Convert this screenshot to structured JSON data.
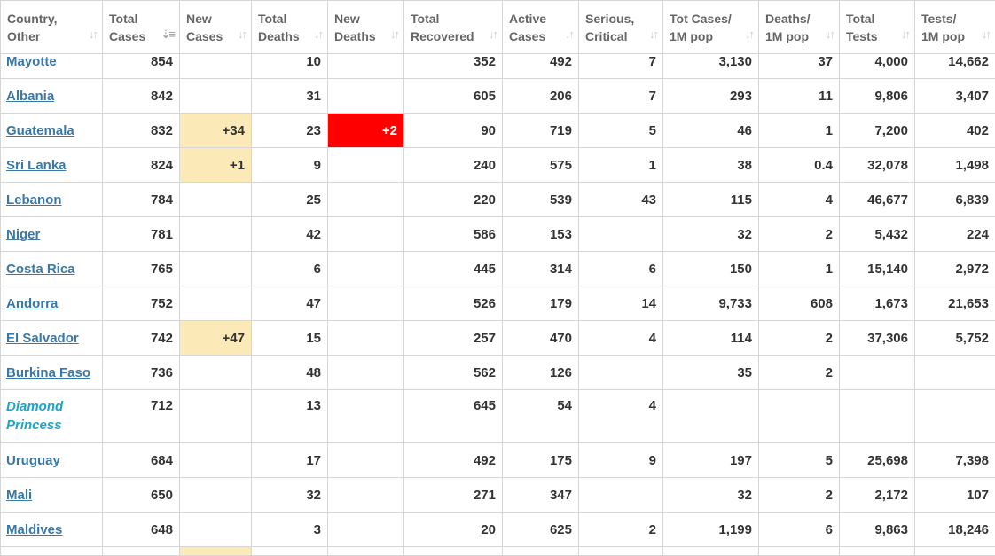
{
  "columns": [
    {
      "key": "country",
      "line1": "Country,",
      "line2": "Other"
    },
    {
      "key": "total_cases",
      "line1": "Total",
      "line2": "Cases",
      "sort": "⇣≡"
    },
    {
      "key": "new_cases",
      "line1": "New",
      "line2": "Cases",
      "sort": "↓↑"
    },
    {
      "key": "total_deaths",
      "line1": "Total",
      "line2": "Deaths",
      "sort": "↓↑"
    },
    {
      "key": "new_deaths",
      "line1": "New",
      "line2": "Deaths",
      "sort": "↓↑"
    },
    {
      "key": "total_recovered",
      "line1": "Total",
      "line2": "Recovered",
      "sort": "↓↑"
    },
    {
      "key": "active_cases",
      "line1": "Active",
      "line2": "Cases",
      "sort": "↓↑"
    },
    {
      "key": "serious",
      "line1": "Serious,",
      "line2": "Critical",
      "sort": "↓↑"
    },
    {
      "key": "tot_cases_1m",
      "line1": "Tot Cases/",
      "line2": "1M pop",
      "sort": "↓↑"
    },
    {
      "key": "deaths_1m",
      "line1": "Deaths/",
      "line2": "1M pop",
      "sort": "↓↑"
    },
    {
      "key": "total_tests",
      "line1": "Total",
      "line2": "Tests",
      "sort": "↓↑"
    },
    {
      "key": "tests_1m",
      "line1": "Tests/",
      "line2": "1M pop",
      "sort": "↓↑"
    }
  ],
  "rows": [
    {
      "country": "Mayotte",
      "total_cases": "854",
      "new_cases": "",
      "total_deaths": "10",
      "new_deaths": "",
      "total_recovered": "352",
      "active_cases": "492",
      "serious": "7",
      "tot_cases_1m": "3,130",
      "deaths_1m": "37",
      "total_tests": "4,000",
      "tests_1m": "14,662"
    },
    {
      "country": "Albania",
      "total_cases": "842",
      "new_cases": "",
      "total_deaths": "31",
      "new_deaths": "",
      "total_recovered": "605",
      "active_cases": "206",
      "serious": "7",
      "tot_cases_1m": "293",
      "deaths_1m": "11",
      "total_tests": "9,806",
      "tests_1m": "3,407"
    },
    {
      "country": "Guatemala",
      "total_cases": "832",
      "new_cases": "+34",
      "total_deaths": "23",
      "new_deaths": "+2",
      "total_recovered": "90",
      "active_cases": "719",
      "serious": "5",
      "tot_cases_1m": "46",
      "deaths_1m": "1",
      "total_tests": "7,200",
      "tests_1m": "402"
    },
    {
      "country": "Sri Lanka",
      "total_cases": "824",
      "new_cases": "+1",
      "total_deaths": "9",
      "new_deaths": "",
      "total_recovered": "240",
      "active_cases": "575",
      "serious": "1",
      "tot_cases_1m": "38",
      "deaths_1m": "0.4",
      "total_tests": "32,078",
      "tests_1m": "1,498"
    },
    {
      "country": "Lebanon",
      "total_cases": "784",
      "new_cases": "",
      "total_deaths": "25",
      "new_deaths": "",
      "total_recovered": "220",
      "active_cases": "539",
      "serious": "43",
      "tot_cases_1m": "115",
      "deaths_1m": "4",
      "total_tests": "46,677",
      "tests_1m": "6,839"
    },
    {
      "country": "Niger",
      "total_cases": "781",
      "new_cases": "",
      "total_deaths": "42",
      "new_deaths": "",
      "total_recovered": "586",
      "active_cases": "153",
      "serious": "",
      "tot_cases_1m": "32",
      "deaths_1m": "2",
      "total_tests": "5,432",
      "tests_1m": "224"
    },
    {
      "country": "Costa Rica",
      "total_cases": "765",
      "new_cases": "",
      "total_deaths": "6",
      "new_deaths": "",
      "total_recovered": "445",
      "active_cases": "314",
      "serious": "6",
      "tot_cases_1m": "150",
      "deaths_1m": "1",
      "total_tests": "15,140",
      "tests_1m": "2,972"
    },
    {
      "country": "Andorra",
      "total_cases": "752",
      "new_cases": "",
      "total_deaths": "47",
      "new_deaths": "",
      "total_recovered": "526",
      "active_cases": "179",
      "serious": "14",
      "tot_cases_1m": "9,733",
      "deaths_1m": "608",
      "total_tests": "1,673",
      "tests_1m": "21,653"
    },
    {
      "country": "El Salvador",
      "total_cases": "742",
      "new_cases": "+47",
      "total_deaths": "15",
      "new_deaths": "",
      "total_recovered": "257",
      "active_cases": "470",
      "serious": "4",
      "tot_cases_1m": "114",
      "deaths_1m": "2",
      "total_tests": "37,306",
      "tests_1m": "5,752"
    },
    {
      "country": "Burkina Faso",
      "total_cases": "736",
      "new_cases": "",
      "total_deaths": "48",
      "new_deaths": "",
      "total_recovered": "562",
      "active_cases": "126",
      "serious": "",
      "tot_cases_1m": "35",
      "deaths_1m": "2",
      "total_tests": "",
      "tests_1m": ""
    },
    {
      "country": "Diamond Princess",
      "special": true,
      "total_cases": "712",
      "new_cases": "",
      "total_deaths": "13",
      "new_deaths": "",
      "total_recovered": "645",
      "active_cases": "54",
      "serious": "4",
      "tot_cases_1m": "",
      "deaths_1m": "",
      "total_tests": "",
      "tests_1m": ""
    },
    {
      "country": "Uruguay",
      "total_cases": "684",
      "new_cases": "",
      "total_deaths": "17",
      "new_deaths": "",
      "total_recovered": "492",
      "active_cases": "175",
      "serious": "9",
      "tot_cases_1m": "197",
      "deaths_1m": "5",
      "total_tests": "25,698",
      "tests_1m": "7,398"
    },
    {
      "country": "Mali",
      "total_cases": "650",
      "new_cases": "",
      "total_deaths": "32",
      "new_deaths": "",
      "total_recovered": "271",
      "active_cases": "347",
      "serious": "",
      "tot_cases_1m": "32",
      "deaths_1m": "2",
      "total_tests": "2,172",
      "tests_1m": "107"
    },
    {
      "country": "Maldives",
      "total_cases": "648",
      "new_cases": "",
      "total_deaths": "3",
      "new_deaths": "",
      "total_recovered": "20",
      "active_cases": "625",
      "serious": "2",
      "tot_cases_1m": "1,199",
      "deaths_1m": "6",
      "total_tests": "9,863",
      "tests_1m": "18,246"
    }
  ],
  "colors": {
    "link": "#3a78a8",
    "special_link": "#1ea4c8",
    "new_cases_bg": "#fbe9b7",
    "new_deaths_bg": "#ff0000"
  }
}
